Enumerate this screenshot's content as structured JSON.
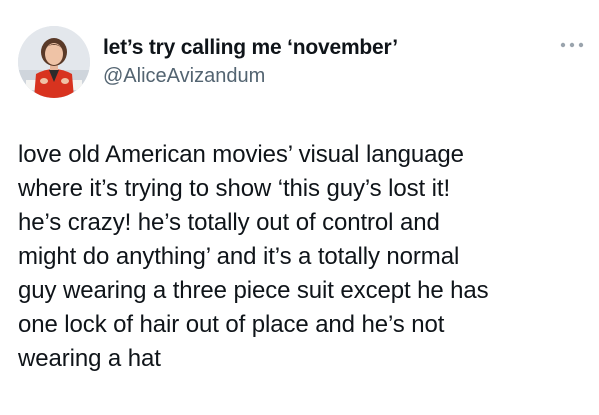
{
  "author": {
    "display_name": "let’s try calling me ‘november’",
    "handle": "@AliceAvizandum",
    "avatar_icon": "profile-photo"
  },
  "more_icon": "ellipsis-icon",
  "tweet": {
    "lines": [
      "love old American movies’ visual language",
      "where it’s trying to show ‘this guy’s lost it!",
      "he’s crazy! he’s totally out of control and",
      "might do anything’ and it’s a totally normal",
      "guy wearing a three piece suit except he has",
      "one lock of hair out of place and he’s not",
      "wearing a hat"
    ]
  },
  "colors": {
    "text": "#0f1419",
    "secondary": "#536471",
    "background": "#ffffff"
  }
}
